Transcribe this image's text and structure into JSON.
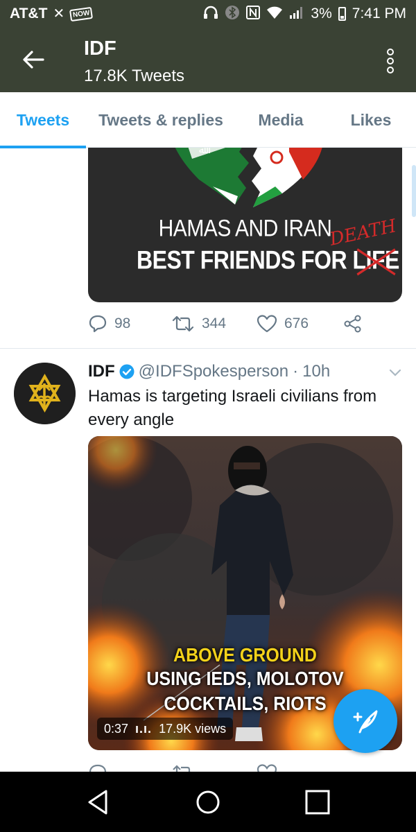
{
  "status_bar": {
    "carrier": "AT&T",
    "now_badge": "NOW",
    "battery": "3%",
    "time": "7:41 PM"
  },
  "header": {
    "title": "IDF",
    "subtitle": "17.8K Tweets"
  },
  "tabs": [
    {
      "label": "Tweets",
      "active": true
    },
    {
      "label": "Tweets & replies",
      "active": false
    },
    {
      "label": "Media",
      "active": false
    },
    {
      "label": "Likes",
      "active": false
    }
  ],
  "tweet1": {
    "image_line1": "HAMAS AND IRAN",
    "image_line2_prefix": "BEST FRIENDS FOR ",
    "image_struck_word": "LIFE",
    "image_correction": "DEATH",
    "replies": "98",
    "retweets": "344",
    "likes": "676"
  },
  "tweet2": {
    "name": "IDF",
    "handle": "@IDFSpokesperson",
    "separator": "·",
    "time": "10h",
    "text": "Hamas is targeting Israeli civilians from every angle",
    "video_caption_1": "ABOVE GROUND",
    "video_caption_2": "USING IEDS, MOLOTOV",
    "video_caption_3": "COCKTAILS, RIOTS",
    "duration": "0:37",
    "views": "17.9K views"
  },
  "colors": {
    "header_bg": "#3a4234",
    "accent": "#1da1f2",
    "muted": "#657786"
  }
}
